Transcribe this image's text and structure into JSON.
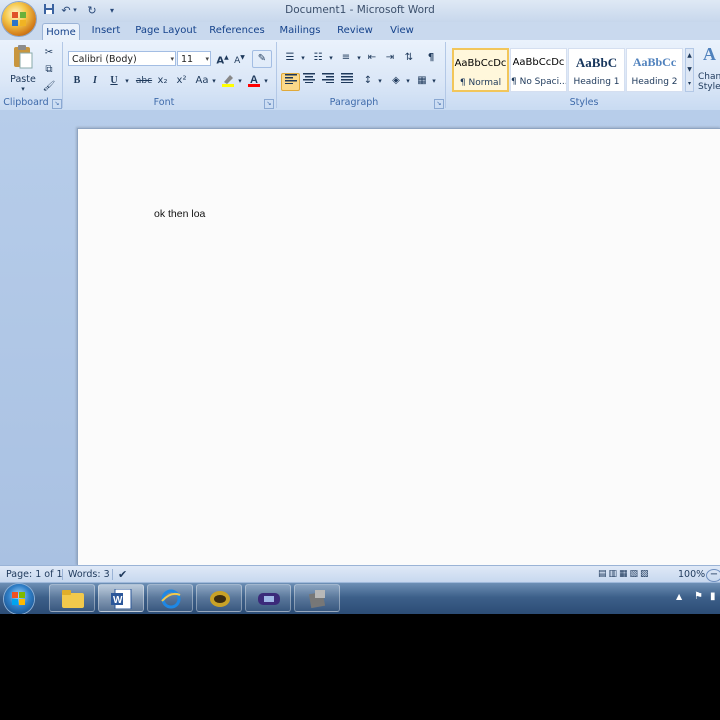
{
  "window": {
    "title": "Document1 - Microsoft Word"
  },
  "tabs": [
    "Home",
    "Insert",
    "Page Layout",
    "References",
    "Mailings",
    "Review",
    "View"
  ],
  "active_tab": "Home",
  "clipboard": {
    "paste_label": "Paste",
    "group_label": "Clipboard"
  },
  "font": {
    "name": "Calibri (Body)",
    "size": "11",
    "group_label": "Font",
    "bold": "B",
    "italic": "I",
    "underline": "U",
    "strike": "abc",
    "subscript": "x₂",
    "superscript": "x²",
    "case": "Aa",
    "grow": "A",
    "shrink": "A",
    "highlight_color": "#ffff00",
    "font_color": "#ff0000"
  },
  "paragraph": {
    "group_label": "Paragraph",
    "pilcrow": "¶"
  },
  "styles": {
    "group_label": "Styles",
    "items": [
      {
        "preview": "AaBbCcDc",
        "name": "¶ Normal"
      },
      {
        "preview": "AaBbCcDc",
        "name": "¶ No Spaci..."
      },
      {
        "preview": "AaBbC",
        "name": "Heading 1"
      },
      {
        "preview": "AaBbCc",
        "name": "Heading 2"
      }
    ],
    "change_label": "Chan Style"
  },
  "document": {
    "text": "ok then loa"
  },
  "status": {
    "page": "Page: 1 of 1",
    "words": "Words: 3",
    "zoom": "100%"
  }
}
